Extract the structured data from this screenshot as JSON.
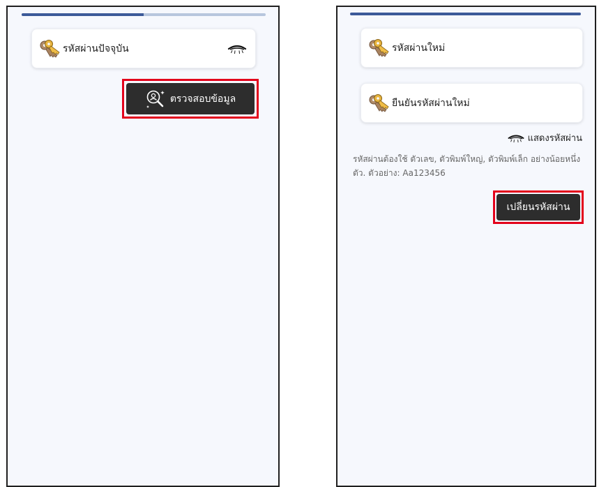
{
  "screens": {
    "verify": {
      "progress_fraction": 0.5,
      "current_password_label": "รหัสผ่านปัจจุบัน",
      "eye_icon": "closed-eye-icon",
      "verify_button_label": "ตรวจสอบข้อมูล",
      "verify_button_icon": "user-search-icon"
    },
    "change": {
      "progress_fraction": 1.0,
      "new_password_label": "รหัสผ่านใหม่",
      "confirm_password_label": "ยืนยันรหัสผ่านใหม่",
      "show_password_label": "แสดงรหัสผ่าน",
      "hint_text": "รหัสผ่านต้องใช้ ตัวเลข, ตัวพิมพ์ใหญ่, ตัวพิมพ์เล็ก อย่างน้อยหนึ่งตัว. ตัวอย่าง: Aa123456",
      "change_button_label": "เปลี่ยนรหัสผ่าน"
    }
  },
  "colors": {
    "progress_fill": "#3c5a99",
    "progress_track": "#b7c6dd",
    "button_bg": "#2d2d2d",
    "highlight": "#e3001b",
    "panel_bg": "#f6f8fd"
  },
  "icons": {
    "field_icon": "keys-icon"
  }
}
